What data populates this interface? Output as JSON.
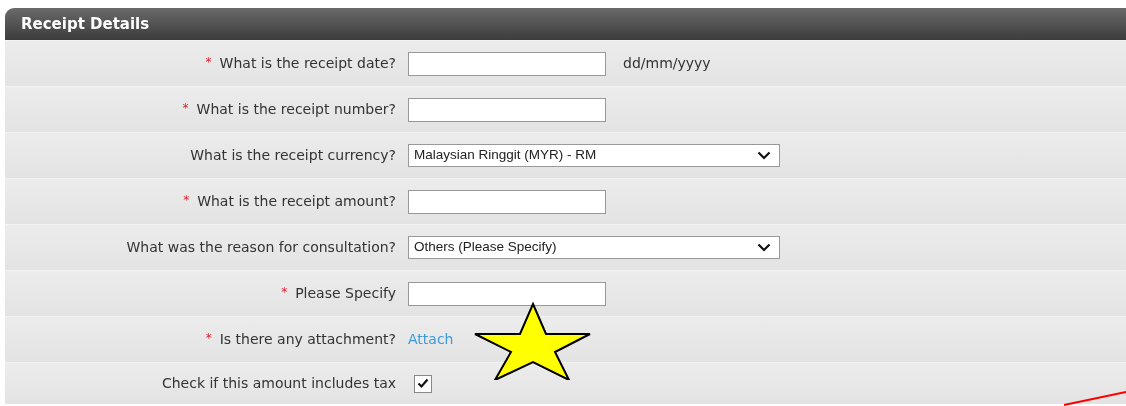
{
  "panel": {
    "title": "Receipt Details"
  },
  "fields": [
    {
      "kind": "text",
      "required_mark": "*",
      "label": "What is the receipt date?",
      "hint": "dd/mm/yyyy"
    },
    {
      "kind": "text",
      "required_mark": "*",
      "label": "What is the receipt number?"
    },
    {
      "kind": "select",
      "label": "What is the receipt currency?",
      "value": "Malaysian Ringgit (MYR) - RM"
    },
    {
      "kind": "text",
      "required_mark": "*",
      "label": "What is the receipt amount?"
    },
    {
      "kind": "select",
      "label": "What was the reason for consultation?",
      "value": "Others (Please Specify)"
    },
    {
      "kind": "text",
      "required_mark": "*",
      "label": "Please Specify"
    },
    {
      "kind": "link",
      "required_mark": "*",
      "label": "Is there any attachment?",
      "value": "Attach"
    },
    {
      "kind": "checkbox",
      "label": "Check if this amount includes tax",
      "checked": true
    }
  ]
}
